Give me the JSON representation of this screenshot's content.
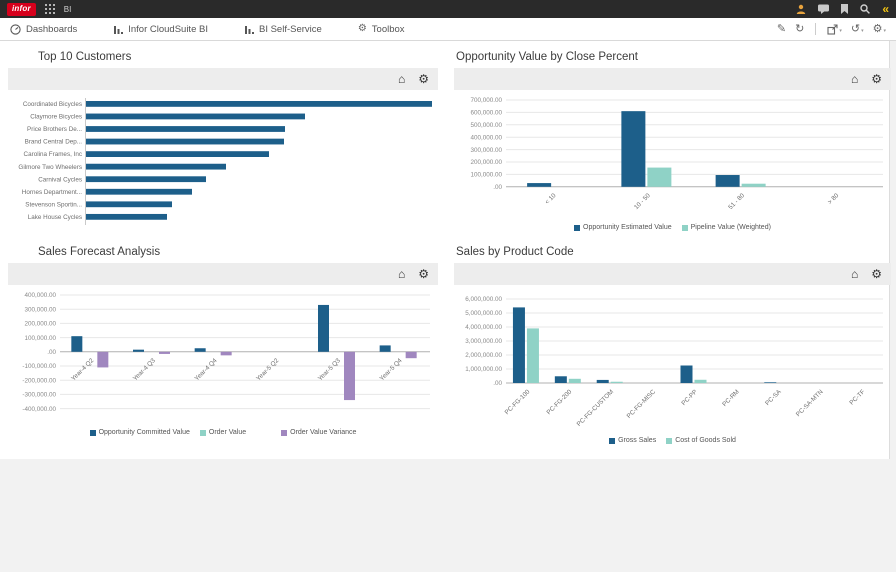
{
  "topbar": {
    "logo_text": "infor",
    "app_label": "BI",
    "right_icons": [
      "user",
      "message",
      "bookmark",
      "search",
      "collapse-panel"
    ]
  },
  "nav": {
    "items": [
      {
        "label": "Dashboards",
        "icon": "gauge"
      },
      {
        "label": "Infor CloudSuite BI",
        "icon": "bar-chart"
      },
      {
        "label": "BI Self-Service",
        "icon": "bar-chart"
      },
      {
        "label": "Toolbox",
        "icon": "gear"
      }
    ],
    "action_icons": [
      "edit",
      "refresh",
      "share",
      "undo-history",
      "settings"
    ]
  },
  "panels": [
    {
      "title": "Top 10 Customers",
      "toolbar_icons": [
        "home",
        "gear"
      ]
    },
    {
      "title": "Opportunity Value by Close Percent",
      "toolbar_icons": [
        "home",
        "gear"
      ]
    },
    {
      "title": "Sales Forecast Analysis",
      "toolbar_icons": [
        "home",
        "gear"
      ]
    },
    {
      "title": "Sales by Product Code",
      "toolbar_icons": [
        "home",
        "gear"
      ]
    }
  ],
  "colors": {
    "bar_blue": "#1d5f8a",
    "bar_teal": "#8fd2c6",
    "bar_purple": "#a087bf",
    "brand_red": "#d6001c",
    "user_icon_orange": "#e8a33d",
    "collapse_yellow": "#f3c511"
  },
  "chart_data": [
    {
      "type": "bar",
      "orientation": "horizontal",
      "title": "Top 10 Customers",
      "categories": [
        "Coordinated Bicycles",
        "Claymore Bicycles",
        "Price Brothers De...",
        "Brand Central Dep...",
        "Carolina Frames, Inc",
        "Gilmore Two Wheelers",
        "Carnival Cycles",
        "Hornes Department...",
        "Stevenson Sportin...",
        "Lake House Cycles"
      ],
      "values": [
        346,
        219,
        199,
        198,
        183,
        140,
        120,
        106,
        86,
        81
      ],
      "units": "relative length (no numeric axis shown)",
      "bar_color": "#1d5f8a",
      "grid": false,
      "legend_position": "none"
    },
    {
      "type": "bar",
      "orientation": "vertical",
      "title": "Opportunity Value by Close Percent",
      "categories": [
        "< 10",
        "10 - 50",
        "51 - 80",
        "> 80"
      ],
      "series": [
        {
          "name": "Opportunity Estimated Value",
          "color": "#1d5f8a",
          "values": [
            30000,
            610000,
            95000,
            0
          ]
        },
        {
          "name": "Pipeline Value (Weighted)",
          "color": "#8fd2c6",
          "values": [
            0,
            155000,
            25000,
            0
          ]
        }
      ],
      "ylim": [
        0,
        700000
      ],
      "ytick_step": 100000,
      "grid": true,
      "legend_position": "bottom"
    },
    {
      "type": "bar",
      "orientation": "vertical",
      "title": "Sales Forecast Analysis",
      "categories": [
        "Year-4 Q2",
        "Year-4 Q3",
        "Year-4 Q4",
        "Year-5 Q2",
        "Year-5 Q3",
        "Year-5 Q4"
      ],
      "series": [
        {
          "name": "Opportunity Committed Value",
          "color": "#1d5f8a",
          "values": [
            110000,
            15000,
            25000,
            0,
            330000,
            45000
          ]
        },
        {
          "name": "Order Value",
          "color": "#8fd2c6",
          "values": [
            0,
            0,
            0,
            0,
            0,
            0
          ]
        },
        {
          "name": "Order Value Variance",
          "color": "#a087bf",
          "values": [
            -110000,
            -15000,
            -25000,
            0,
            -340000,
            -45000
          ]
        }
      ],
      "ylim": [
        -400000,
        400000
      ],
      "ytick_step": 100000,
      "grid": true,
      "legend_position": "bottom"
    },
    {
      "type": "bar",
      "orientation": "vertical",
      "title": "Sales by Product Code",
      "categories": [
        "PC-FG-100",
        "PC-FG-200",
        "PC-FG-CUSTOM",
        "PC-FG-MISC",
        "PC-PP",
        "PC-RM",
        "PC-SA",
        "PC-SA-MTN",
        "PC-TF"
      ],
      "series": [
        {
          "name": "Gross Sales",
          "color": "#1d5f8a",
          "values": [
            5400000,
            480000,
            220000,
            0,
            1250000,
            0,
            50000,
            0,
            0
          ]
        },
        {
          "name": "Cost of Goods Sold",
          "color": "#8fd2c6",
          "values": [
            3900000,
            300000,
            90000,
            0,
            230000,
            0,
            0,
            0,
            0
          ]
        }
      ],
      "ylim": [
        0,
        6000000
      ],
      "ytick_step": 1000000,
      "grid": true,
      "legend_position": "bottom"
    }
  ]
}
